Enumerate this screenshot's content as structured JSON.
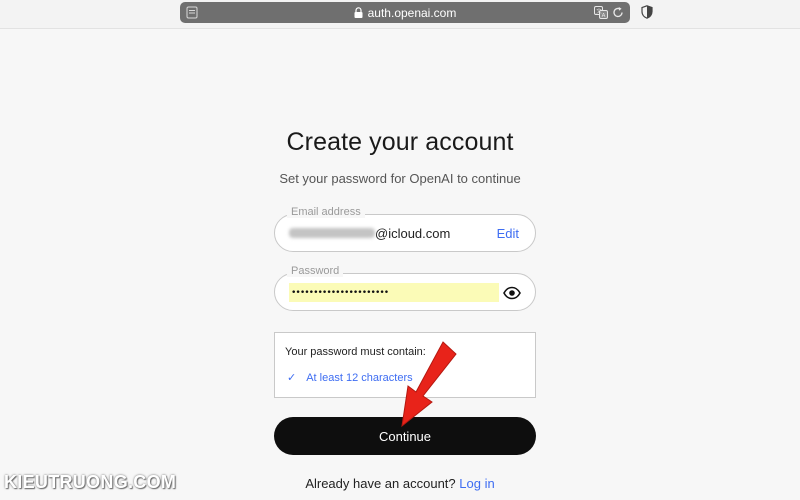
{
  "browser": {
    "url": "auth.openai.com",
    "icons": [
      "reader-icon",
      "lock-icon",
      "translate-icon",
      "reload-icon",
      "shield-icon"
    ]
  },
  "page": {
    "title": "Create your account",
    "subtitle": "Set your password for OpenAI to continue"
  },
  "email_field": {
    "label": "Email address",
    "value_visible": "@icloud.com",
    "edit_label": "Edit"
  },
  "password_field": {
    "label": "Password",
    "value": "••••••••••••••••••••••",
    "icon": "eye-icon"
  },
  "requirements": {
    "heading": "Your password must contain:",
    "items": [
      {
        "check": "✓",
        "label": "At least 12 characters"
      }
    ]
  },
  "continue_label": "Continue",
  "footer": {
    "prompt": "Already have an account?",
    "login_label": "Log in"
  },
  "watermark": "KIEUTRUONG.COM",
  "colors": {
    "accent": "#3e6df2",
    "button_bg": "#0e0e0e",
    "autofill_highlight": "#fbfbb7",
    "annotation_arrow": "#e8231a"
  }
}
